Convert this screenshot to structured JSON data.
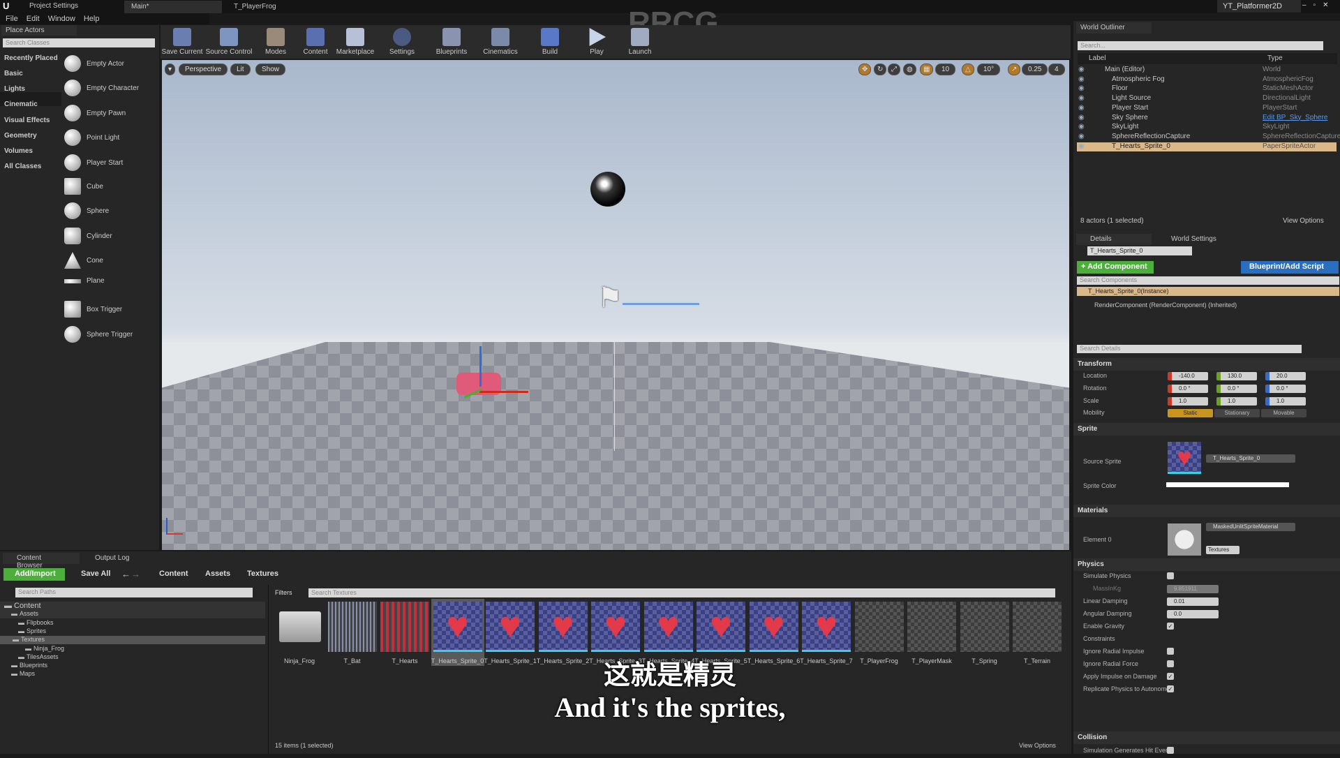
{
  "titlebar": {
    "project_settings": "Project Settings",
    "doc_tab": "Main*",
    "doc_tab2": "T_PlayerFrog",
    "project_name": "YT_Platformer2D",
    "watermark": "RRCG"
  },
  "menu": [
    "File",
    "Edit",
    "Window",
    "Help"
  ],
  "place_actors": {
    "tab": "Place Actors",
    "search_placeholder": "Search Classes",
    "categories": [
      "Recently Placed",
      "Basic",
      "Lights",
      "Cinematic",
      "Visual Effects",
      "Geometry",
      "Volumes",
      "All Classes"
    ],
    "items": [
      "Empty Actor",
      "Empty Character",
      "Empty Pawn",
      "Point Light",
      "Player Start",
      "Cube",
      "Sphere",
      "Cylinder",
      "Cone",
      "Plane",
      "Box Trigger",
      "Sphere Trigger"
    ]
  },
  "toolbar": [
    "Save Current",
    "Source Control",
    "Modes",
    "Content",
    "Marketplace",
    "Settings",
    "Blueprints",
    "Cinematics",
    "Build",
    "Play",
    "Launch"
  ],
  "viewport": {
    "perspective": "Perspective",
    "lit": "Lit",
    "show": "Show",
    "grid_snap": "10",
    "rot_snap": "10°",
    "scale_snap": "0.25",
    "cam_speed": "4"
  },
  "outliner": {
    "tab": "World Outliner",
    "search_placeholder": "Search...",
    "col_label": "Label",
    "col_type": "Type",
    "rows": [
      {
        "label": "Main (Editor)",
        "type": "World"
      },
      {
        "label": "Atmospheric Fog",
        "type": "AtmosphericFog"
      },
      {
        "label": "Floor",
        "type": "StaticMeshActor"
      },
      {
        "label": "Light Source",
        "type": "DirectionalLight"
      },
      {
        "label": "Player Start",
        "type": "PlayerStart"
      },
      {
        "label": "Sky Sphere",
        "type": "Edit BP_Sky_Sphere"
      },
      {
        "label": "SkyLight",
        "type": "SkyLight"
      },
      {
        "label": "SphereReflectionCapture",
        "type": "SphereReflectionCapture"
      },
      {
        "label": "T_Hearts_Sprite_0",
        "type": "PaperSpriteActor"
      }
    ],
    "status": "8 actors (1 selected)",
    "view_options": "View Options"
  },
  "details": {
    "tab": "Details",
    "tab2": "World Settings",
    "actor_name": "T_Hearts_Sprite_0",
    "add_component": "+ Add Component",
    "blueprint": "Blueprint/Add Script",
    "search_components": "Search Components",
    "instance": "T_Hearts_Sprite_0(Instance)",
    "render_component": "RenderComponent (RenderComponent) (Inherited)",
    "search_details": "Search Details",
    "transform": {
      "title": "Transform",
      "location_label": "Location",
      "rotation_label": "Rotation",
      "scale_label": "Scale",
      "mobility_label": "Mobility",
      "location": [
        "-140.0",
        "130.0",
        "20.0"
      ],
      "rotation": [
        "0.0 °",
        "0.0 °",
        "0.0 °"
      ],
      "scale": [
        "1.0",
        "1.0",
        "1.0"
      ],
      "mobility": [
        "Static",
        "Stationary",
        "Movable"
      ],
      "mobility_selected": "Static"
    },
    "sprite": {
      "title": "Sprite",
      "source_label": "Source Sprite",
      "source_value": "T_Hearts_Sprite_0",
      "color_label": "Sprite Color",
      "color": "#ffffff"
    },
    "materials": {
      "title": "Materials",
      "element_label": "Element 0",
      "element_value": "MaskedUnlitSpriteMaterial",
      "textures": "Textures"
    },
    "physics": {
      "title": "Physics",
      "rows": [
        {
          "label": "Simulate Physics",
          "checked": false
        },
        {
          "label": "MassInKg",
          "value": "9.851911"
        },
        {
          "label": "Linear Damping",
          "value": "0.01"
        },
        {
          "label": "Angular Damping",
          "value": "0.0"
        },
        {
          "label": "Enable Gravity",
          "checked": true
        },
        {
          "label": "Constraints"
        },
        {
          "label": "Ignore Radial Impulse",
          "checked": false
        },
        {
          "label": "Ignore Radial Force",
          "checked": false
        },
        {
          "label": "Apply Impulse on Damage",
          "checked": true
        },
        {
          "label": "Replicate Physics to Autonomo",
          "checked": true
        }
      ]
    },
    "collision": {
      "title": "Collision",
      "row": "Simulation Generates Hit Event"
    }
  },
  "content_browser": {
    "tab": "Content Browser",
    "tab2": "Output Log",
    "add_import": "Add/Import",
    "save_all": "Save All",
    "breadcrumb": [
      "Content",
      "Assets",
      "Textures"
    ],
    "search_paths": "Search Paths",
    "filters": "Filters",
    "search_textures": "Search Textures",
    "tree": [
      "Content",
      "Assets",
      "Flipbooks",
      "Sprites",
      "Textures",
      "Ninja_Frog",
      "TilesAssets",
      "Blueprints",
      "Maps"
    ],
    "assets": [
      "Ninja_Frog",
      "T_Bat",
      "T_Hearts",
      "T_Hearts_Sprite_0",
      "T_Hearts_Sprite_1",
      "T_Hearts_Sprite_2",
      "T_Hearts_Sprite_3",
      "T_Hearts_Sprite_4",
      "T_Hearts_Sprite_5",
      "T_Hearts_Sprite_6",
      "T_Hearts_Sprite_7",
      "T_PlayerFrog",
      "T_PlayerMask",
      "T_Spring",
      "T_Terrain"
    ],
    "selected_asset": "T_Hearts_Sprite_0",
    "status": "15 items (1 selected)",
    "view_options": "View Options"
  },
  "subtitles": {
    "zh": "这就是精灵",
    "en": "And it's the sprites,"
  },
  "colors": {
    "selection": "#d9b88a",
    "add_green": "#4caf3c",
    "blueprint_blue": "#2a6fbf",
    "static_orange": "#c8961e"
  }
}
